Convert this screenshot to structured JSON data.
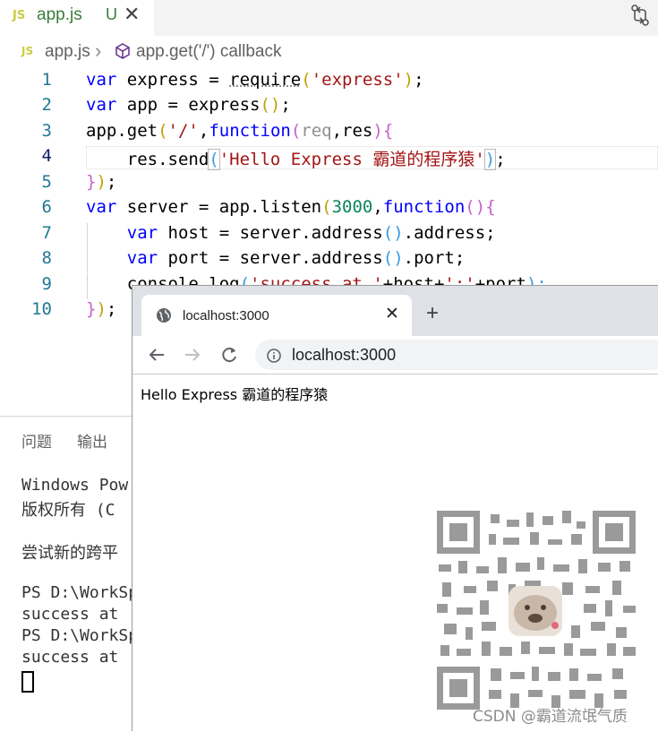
{
  "tab": {
    "icon": "JS",
    "filename": "app.js",
    "status": "U"
  },
  "breadcrumb": {
    "icon": "JS",
    "file": "app.js",
    "symbol": "app.get('/') callback"
  },
  "line_numbers": [
    "1",
    "2",
    "3",
    "4",
    "5",
    "6",
    "7",
    "8",
    "9",
    "10"
  ],
  "code": [
    [
      "var",
      " express = ",
      "require",
      "(",
      "'express'",
      ")",
      ";"
    ],
    [
      "var",
      " app = express",
      "()",
      ";"
    ],
    [
      "app.get",
      "(",
      "'/'",
      ",",
      "function",
      "(",
      "req",
      ",res",
      ")",
      "{"
    ],
    [
      "    res.send",
      "(",
      "'Hello Express 霸道的程序猿'",
      ")",
      ";"
    ],
    [
      "}",
      ")",
      ";"
    ],
    [
      "var",
      " server = app.listen",
      "(",
      "3000",
      ",",
      "function",
      "()",
      "{"
    ],
    [
      "    ",
      "var",
      " host = server.address",
      "()",
      ".address;"
    ],
    [
      "    ",
      "var",
      " port = server.address",
      "()",
      ".port;"
    ],
    [
      "    console.log",
      "(",
      "'success at '",
      "+host+",
      "':'",
      "+port",
      ");"
    ],
    [
      "}",
      ")",
      ";"
    ]
  ],
  "panel": {
    "tab_problems": "问题",
    "tab_output": "输出"
  },
  "terminal": [
    "Windows Pow",
    "版权所有 (C",
    "",
    "尝试新的跨平",
    "",
    "PS D:\\WorkSp",
    "success at",
    "PS D:\\WorkSp",
    "success at"
  ],
  "browser": {
    "tab_title": "localhost:3000",
    "url": "localhost:3000",
    "page_text": "Hello Express 霸道的程序猿"
  },
  "watermark": "CSDN @霸道流氓气质"
}
